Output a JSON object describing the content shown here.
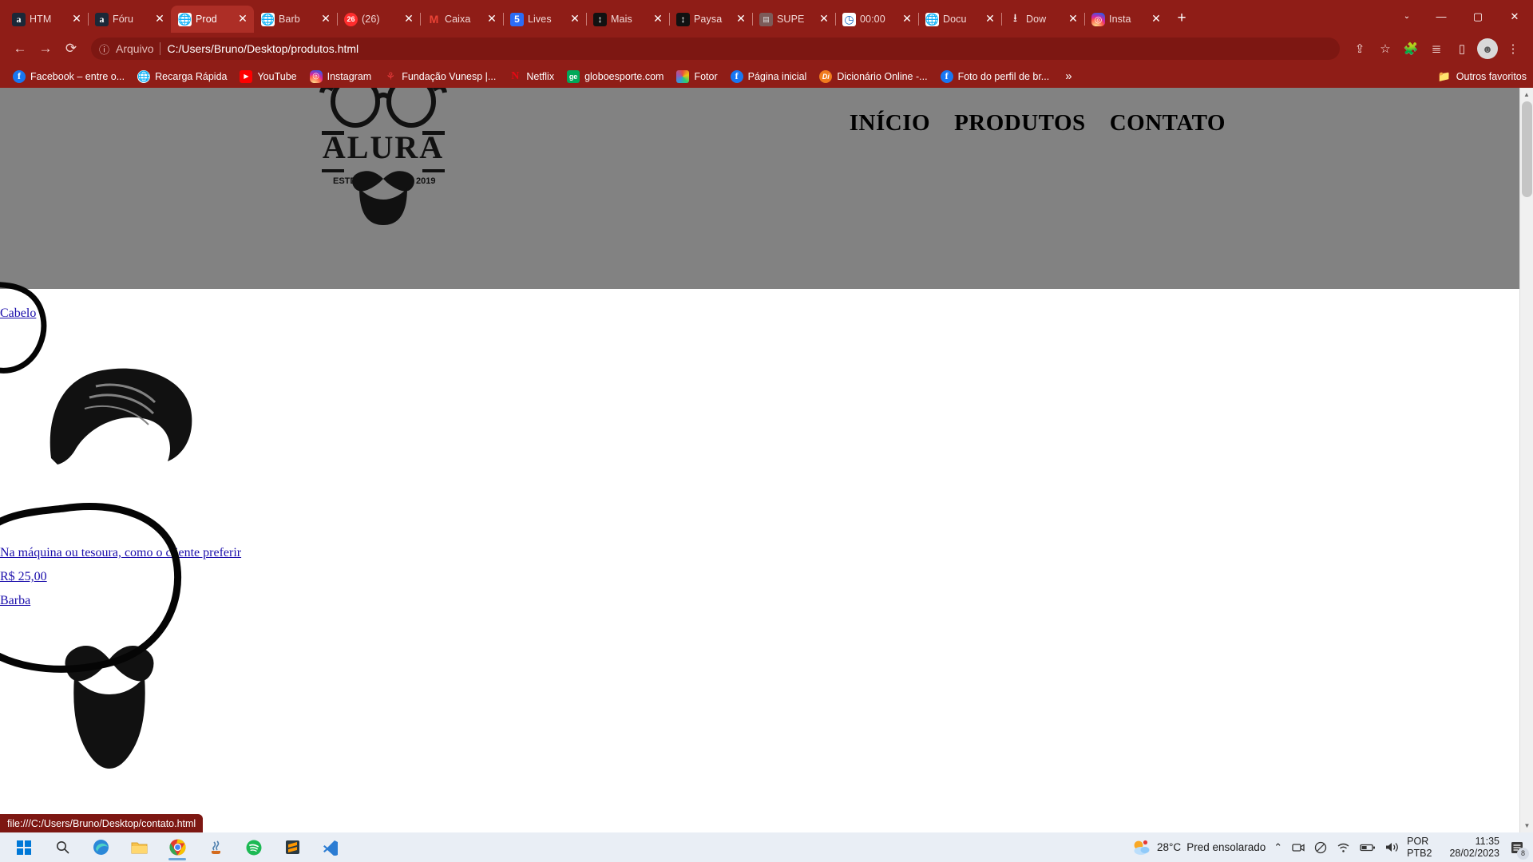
{
  "browser": {
    "tabs": [
      {
        "title": "HTM",
        "icon": "amazon-icon",
        "active": false
      },
      {
        "title": "Fóru",
        "icon": "amazon-icon",
        "active": false
      },
      {
        "title": "Prod",
        "icon": "globe-icon",
        "active": true
      },
      {
        "title": "Barb",
        "icon": "globe-icon",
        "active": false
      },
      {
        "title": "(26) ",
        "icon": "notification-count-icon",
        "active": false
      },
      {
        "title": "Caixa",
        "icon": "gmail-icon",
        "active": false
      },
      {
        "title": "Lives",
        "icon": "blue-square-icon",
        "active": false
      },
      {
        "title": "Mais",
        "icon": "updown-arrow-icon",
        "active": false
      },
      {
        "title": "Paysa",
        "icon": "updown-arrow-icon",
        "active": false
      },
      {
        "title": "SUPE",
        "icon": "placeholder-icon",
        "active": false
      },
      {
        "title": "00:00",
        "icon": "clock-icon",
        "active": false
      },
      {
        "title": "Docu",
        "icon": "globe-icon",
        "active": false
      },
      {
        "title": "Dow",
        "icon": "download-icon",
        "active": false
      },
      {
        "title": "Insta",
        "icon": "instagram-icon",
        "active": false
      }
    ],
    "new_tab_label": "+",
    "close_label": "✕",
    "window_controls": {
      "caret": "⌄",
      "minimize": "—",
      "maximize": "▢",
      "close": "✕"
    },
    "toolbar": {
      "back": "←",
      "forward": "→",
      "reload": "⟳",
      "scheme_label": "Arquivo",
      "url": "C:/Users/Bruno/Desktop/produtos.html",
      "info_icon": "ⓘ",
      "share": "⇪",
      "bookmark_star": "☆",
      "extensions": "🧩",
      "reading_list": "≣",
      "side_panel": "▯",
      "profile": "☻",
      "menu": "⋮"
    },
    "bookmarks": [
      {
        "label": "Facebook – entre o...",
        "icon": "facebook-icon"
      },
      {
        "label": "Recarga Rápida",
        "icon": "globe-icon"
      },
      {
        "label": "YouTube",
        "icon": "youtube-icon"
      },
      {
        "label": "Instagram",
        "icon": "instagram-icon"
      },
      {
        "label": "Fundação Vunesp |...",
        "icon": "vunesp-icon"
      },
      {
        "label": "Netflix",
        "icon": "netflix-icon"
      },
      {
        "label": "globoesporte.com",
        "icon": "globoesporte-icon"
      },
      {
        "label": "Fotor",
        "icon": "fotor-icon"
      },
      {
        "label": "Página inicial",
        "icon": "facebook-icon"
      },
      {
        "label": "Dicionário Online -...",
        "icon": "dicionario-icon"
      },
      {
        "label": "Foto do perfil de br...",
        "icon": "facebook-icon"
      }
    ],
    "bookmarks_overflow": "»",
    "other_bookmarks": "Outros favoritos",
    "status_url": "file:///C:/Users/Bruno/Desktop/contato.html"
  },
  "page": {
    "logo_text": "ALURA",
    "logo_estd": "ESTD",
    "logo_year": "2019",
    "nav": [
      "INÍCIO",
      "PRODUTOS",
      "CONTATO"
    ],
    "links": {
      "cabelo": "Cabelo",
      "descricao": "Na máquina ou tesoura, como o cliente preferir",
      "preco": "R$ 25,00",
      "barba": "Barba"
    },
    "images": {
      "hair": "hair-illustration",
      "beard": "beard-illustration"
    },
    "header_bg": "#828282"
  },
  "taskbar": {
    "apps": [
      {
        "name": "start-button",
        "glyph": "⊞",
        "active": false
      },
      {
        "name": "search-button",
        "glyph": "🔍",
        "active": false
      },
      {
        "name": "edge-button",
        "glyph": "e",
        "active": false
      },
      {
        "name": "file-explorer-button",
        "glyph": "🗂",
        "active": false
      },
      {
        "name": "chrome-button",
        "glyph": "◉",
        "active": true
      },
      {
        "name": "java-button",
        "glyph": "☕",
        "active": false
      },
      {
        "name": "spotify-button",
        "glyph": "♫",
        "active": false
      },
      {
        "name": "sublime-button",
        "glyph": "S",
        "active": false
      },
      {
        "name": "vscode-button",
        "glyph": "✕",
        "active": false
      }
    ],
    "weather_temp": "28°C",
    "weather_desc": "Pred ensolarado",
    "tray": [
      "^",
      "camera",
      "no-entry",
      "wifi",
      "battery",
      "volume"
    ],
    "lang_line1": "POR",
    "lang_line2": "PTB2",
    "time": "11:35",
    "date": "28/02/2023",
    "notification_count": "8"
  }
}
